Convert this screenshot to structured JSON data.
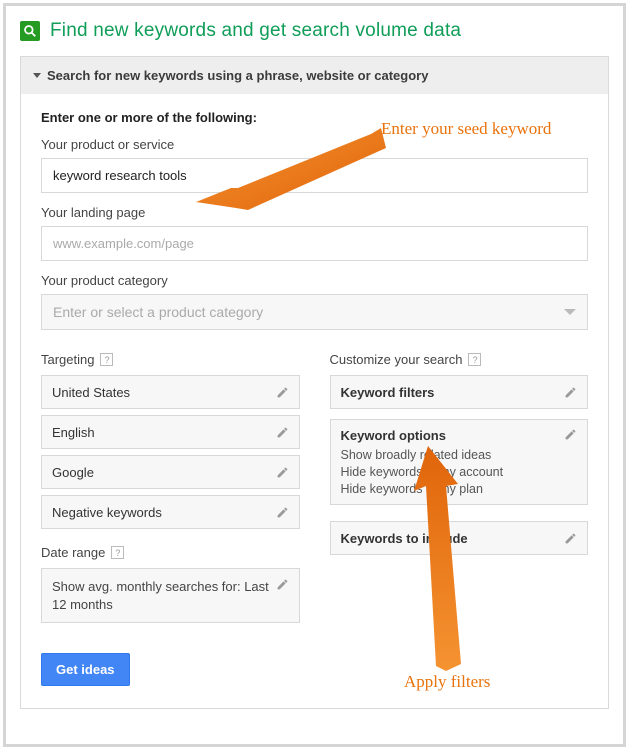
{
  "header": {
    "title": "Find new keywords and get search volume data"
  },
  "accordion": {
    "title": "Search for new keywords using a phrase, website or category"
  },
  "form": {
    "intro": "Enter one or more of the following:",
    "product_label": "Your product or service",
    "product_value": "keyword research tools",
    "landing_label": "Your landing page",
    "landing_placeholder": "www.example.com/page",
    "category_label": "Your product category",
    "category_placeholder": "Enter or select a product category"
  },
  "targeting": {
    "label": "Targeting",
    "items": [
      "United States",
      "English",
      "Google",
      "Negative keywords"
    ]
  },
  "daterange": {
    "label": "Date range",
    "text": "Show avg. monthly searches for: Last 12 months"
  },
  "customize": {
    "label": "Customize your search",
    "filters_title": "Keyword filters",
    "options_title": "Keyword options",
    "options_lines": [
      "Show broadly related ideas",
      "Hide keywords in my account",
      "Hide keywords in my plan"
    ],
    "include_title": "Keywords to include"
  },
  "button": {
    "get_ideas": "Get ideas"
  },
  "annotations": {
    "seed": "Enter your seed keyword",
    "filters": "Apply filters"
  },
  "colors": {
    "brand_green": "#0f9d58",
    "primary_blue": "#4285f4",
    "annotation_orange": "#e8720c"
  }
}
